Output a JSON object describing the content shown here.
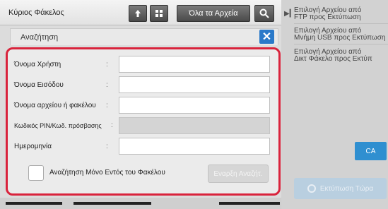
{
  "header": {
    "title": "Κύριος Φάκελος",
    "up_icon": "upload-arrow-icon",
    "grid_icon": "grid-view-icon",
    "all_files_label": "Όλα τα Αρχεία",
    "search_icon": "search-icon"
  },
  "dialog": {
    "title": "Αναζήτηση",
    "close_symbol": "✕"
  },
  "form": {
    "fields": [
      {
        "label": "Όνομα Χρήστη",
        "colon": ":",
        "value": ""
      },
      {
        "label": "Όνομα Εισόδου",
        "colon": ":",
        "value": ""
      },
      {
        "label": "Όνομα αρχείου ή φακέλου",
        "colon": ":",
        "value": ""
      },
      {
        "label": "Κωδικός PIN/Κωδ. πρόσβασης",
        "colon": ":",
        "value": ""
      },
      {
        "label": "Ημερομηνία",
        "colon": ":",
        "value": ""
      }
    ],
    "checkbox_label": "Αναζήτηση Μόνο Εντός του Φακέλου",
    "checkbox_checked": false,
    "start_button": "Εναρξη Αναζήτ."
  },
  "sidebar": {
    "items": [
      {
        "label_line1": "Επιλογή Αρχείου από",
        "label_line2": "FTP προς Εκτύπωση"
      },
      {
        "label_line1": "Επιλογή Αρχείου από",
        "label_line2": "Μνήμη USB προς Εκτύπωση"
      },
      {
        "label_line1": "Επιλογή Αρχείου από",
        "label_line2": "Δικτ Φάκελο προς Εκτύπ"
      }
    ],
    "ca_label": "CA",
    "print_label": "Εκτύπωση Τώρα"
  },
  "colors": {
    "accent": "#2a79c9",
    "panel_border": "#d9233c",
    "ca_button": "#2f8fd0"
  }
}
